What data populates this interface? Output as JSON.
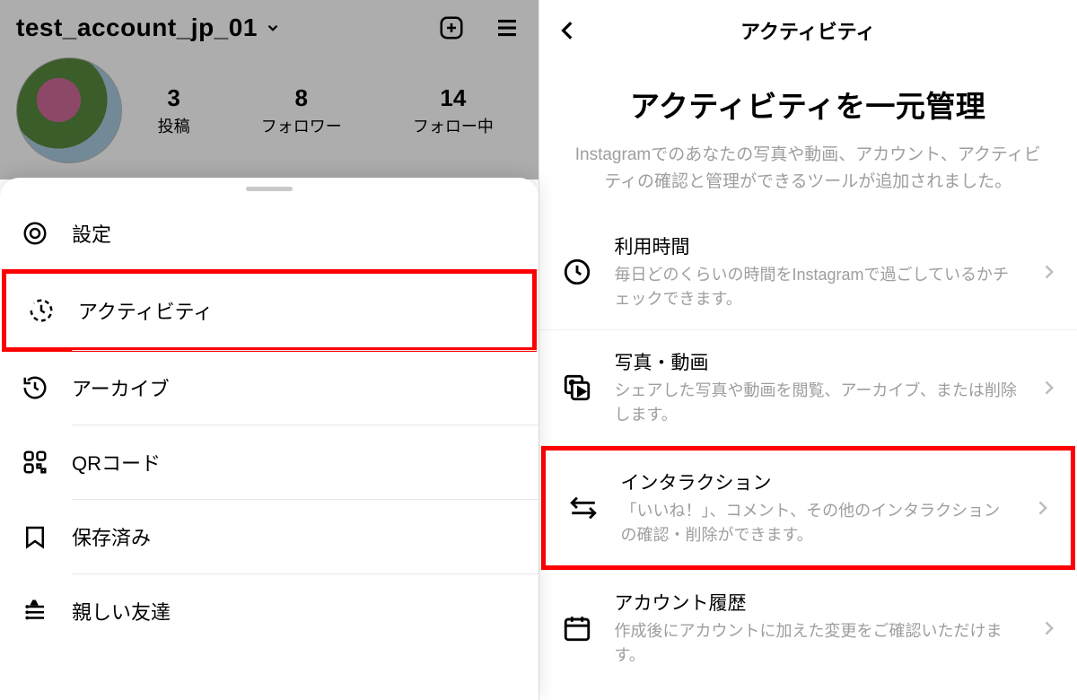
{
  "left": {
    "username": "test_account_jp_01",
    "stats": {
      "posts": {
        "count": "3",
        "label": "投稿"
      },
      "followers": {
        "count": "8",
        "label": "フォロワー"
      },
      "following": {
        "count": "14",
        "label": "フォロー中"
      }
    },
    "menu": {
      "settings": "設定",
      "activity": "アクティビティ",
      "archive": "アーカイブ",
      "qr": "QRコード",
      "saved": "保存済み",
      "closeFriends": "親しい友達"
    }
  },
  "right": {
    "header_title": "アクティビティ",
    "hero_title": "アクティビティを一元管理",
    "hero_desc": "Instagramでのあなたの写真や動画、アカウント、アクティビティの確認と管理ができるツールが追加されました。",
    "items": {
      "time": {
        "title": "利用時間",
        "desc": "毎日どのくらいの時間をInstagramで過ごしているかチェックできます。"
      },
      "media": {
        "title": "写真・動画",
        "desc": "シェアした写真や動画を閲覧、アーカイブ、または削除します。"
      },
      "interactions": {
        "title": "インタラクション",
        "desc": "「いいね！」、コメント、その他のインタラクションの確認・削除ができます。"
      },
      "history": {
        "title": "アカウント履歴",
        "desc": "作成後にアカウントに加えた変更をご確認いただけます。"
      }
    }
  }
}
